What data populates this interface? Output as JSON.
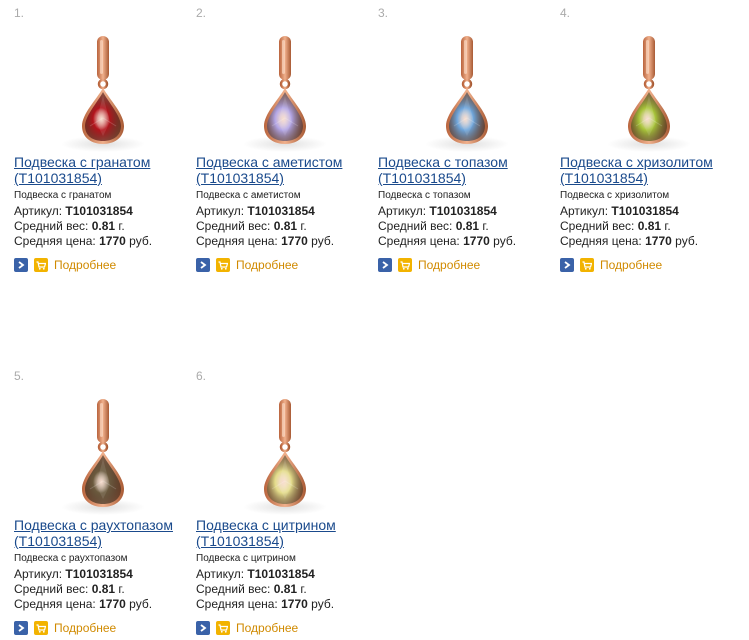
{
  "labels": {
    "article": "Артикул:",
    "weight": "Средний вес:",
    "weight_unit": "г.",
    "price": "Средняя цена:",
    "price_unit": "руб.",
    "more": "Подробнее"
  },
  "items": [
    {
      "num": "1.",
      "title": "Подвеска с гранатом",
      "code": "(T101031854)",
      "sub": "Подвеска с гранатом",
      "article": "T101031854",
      "weight": "0.81",
      "price": "1770",
      "stone_color": "#b3141c"
    },
    {
      "num": "2.",
      "title": "Подвеска с аметистом",
      "code": "(T101031854)",
      "sub": "Подвеска с аметистом",
      "article": "T101031854",
      "weight": "0.81",
      "price": "1770",
      "stone_color": "#b3a6e6"
    },
    {
      "num": "3.",
      "title": "Подвеска с топазом",
      "code": "(T101031854)",
      "sub": "Подвеска с топазом",
      "article": "T101031854",
      "weight": "0.81",
      "price": "1770",
      "stone_color": "#6fa6dc"
    },
    {
      "num": "4.",
      "title": "Подвеска с хризолитом",
      "code": "(T101031854)",
      "sub": "Подвеска с хризолитом",
      "article": "T101031854",
      "weight": "0.81",
      "price": "1770",
      "stone_color": "#a8c43a"
    },
    {
      "num": "5.",
      "title": "Подвеска с раухтопазом",
      "code": "(T101031854)",
      "sub": "Подвеска с раухтопазом",
      "article": "T101031854",
      "weight": "0.81",
      "price": "1770",
      "stone_color": "#6b5a3e"
    },
    {
      "num": "6.",
      "title": "Подвеска с цитрином",
      "code": "(T101031854)",
      "sub": "Подвеска с цитрином",
      "article": "T101031854",
      "weight": "0.81",
      "price": "1770",
      "stone_color": "#e4dc8a"
    }
  ],
  "colors": {
    "link": "#1a4a8c",
    "more": "#d08a00",
    "gold": "#d2875a"
  }
}
